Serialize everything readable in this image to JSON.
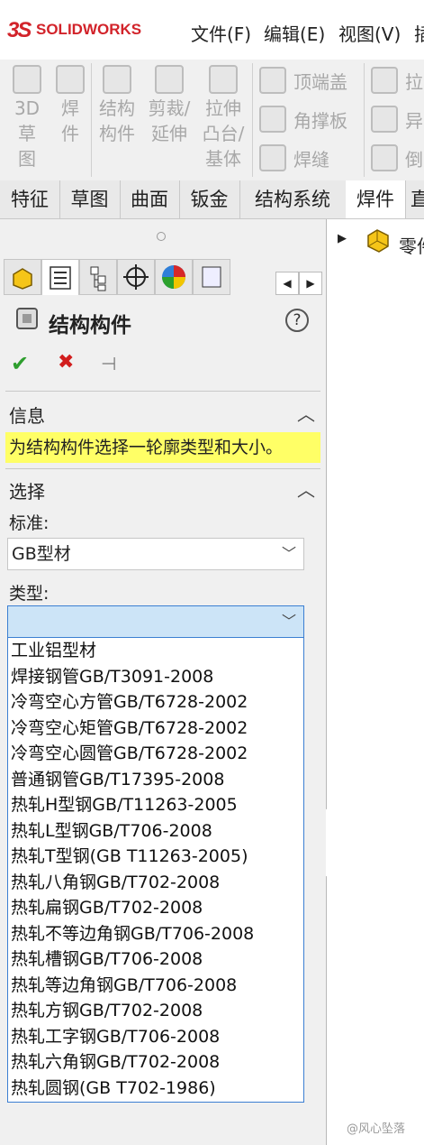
{
  "app": {
    "logo_prefix": "3S",
    "logo_name": "SOLIDWORKS"
  },
  "menu": [
    "文件(F)",
    "编辑(E)",
    "视图(V)",
    "插"
  ],
  "command_manager": {
    "big_buttons": [
      "3D\n草\n图",
      "焊\n件",
      "结构\n构件",
      "剪裁/\n延伸",
      "拉伸\n凸台/\n基体"
    ],
    "row_buttons": [
      "顶端盖",
      "角撑板",
      "焊缝"
    ],
    "right_buttons": [
      "拉",
      "异",
      "倒"
    ]
  },
  "tabs": [
    "特征",
    "草图",
    "曲面",
    "钣金",
    "结构系统",
    "焊件",
    "直"
  ],
  "property_manager": {
    "title": "结构构件",
    "help": "?",
    "ok": "✔",
    "cancel": "✖",
    "pin": "⊣",
    "info_header": "信息",
    "info_text": "为结构构件选择一轮廓类型和大小。",
    "selection_header": "选择",
    "standard_label": "标准:",
    "standard_value": "GB型材",
    "type_label": "类型:",
    "type_value": "",
    "type_options": [
      "工业铝型材",
      "焊接钢管GB/T3091-2008",
      "冷弯空心方管GB/T6728-2002",
      "冷弯空心矩管GB/T6728-2002",
      "冷弯空心圆管GB/T6728-2002",
      "普通钢管GB/T17395-2008",
      "热轧H型钢GB/T11263-2005",
      "热轧L型钢GB/T706-2008",
      "热轧T型钢(GB T11263-2005)",
      "热轧八角钢GB/T702-2008",
      "热轧扁钢GB/T702-2008",
      "热轧不等边角钢GB/T706-2008",
      "热轧槽钢GB/T706-2008",
      "热轧等边角钢GB/T706-2008",
      "热轧方钢GB/T702-2008",
      "热轧工字钢GB/T706-2008",
      "热轧六角钢GB/T702-2008",
      "热轧圆钢(GB T702-1986)"
    ]
  },
  "feature_tree": {
    "root_label": "零件"
  },
  "watermark": "@风心坠落",
  "colors": {
    "brand": "#d2232a",
    "info_bg": "#ffff66",
    "ok": "#2e9e2e",
    "cancel": "#d11d1d",
    "selected": "#cce4f7"
  }
}
